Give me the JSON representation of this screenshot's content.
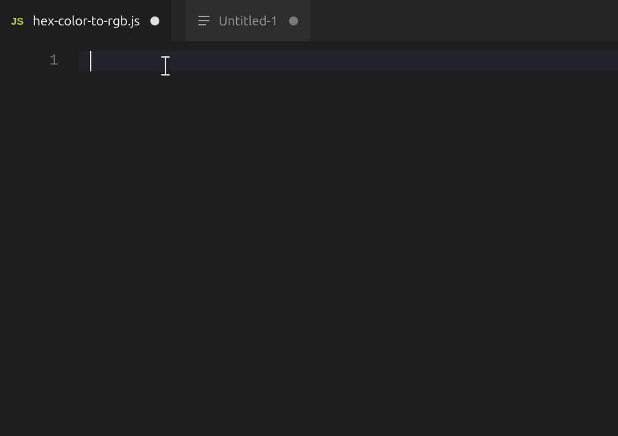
{
  "tabs": [
    {
      "icon_letters": "JS",
      "icon_color": "#cbcb41",
      "label": "hex-color-to-rgb.js",
      "modified": true,
      "active": true
    },
    {
      "icon_name": "text-lines-icon",
      "label": "Untitled-1",
      "modified": true,
      "active": false
    }
  ],
  "editor": {
    "line_numbers": [
      "1"
    ],
    "content": ""
  }
}
